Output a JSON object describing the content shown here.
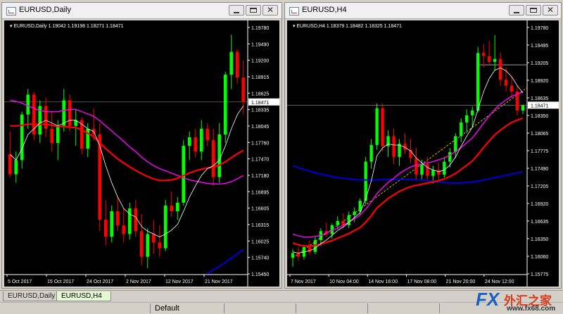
{
  "windows": [
    {
      "title": "EURUSD,Daily",
      "header": "EURUSD,Daily  1.19042 1.19198 1.18271 1.18471",
      "price_axis": [
        "1.19780",
        "1.19490",
        "1.19200",
        "1.18915",
        "1.18625",
        "1.18335",
        "1.18045",
        "1.17760",
        "1.17470",
        "1.17180",
        "1.16895",
        "1.16605",
        "1.16315",
        "1.16025",
        "1.15740",
        "1.15450"
      ],
      "price_min": 1.1545,
      "price_max": 1.1978,
      "current_price": "1.18471",
      "time_axis": [
        "5 Oct 2017",
        "15 Oct 2017",
        "24 Oct 2017",
        "2 Nov 2017",
        "12 Nov 2017",
        "21 Nov 2017"
      ],
      "candles": [
        [
          1.1755,
          1.1795,
          1.1715,
          1.172
        ],
        [
          1.172,
          1.176,
          1.1705,
          1.1745
        ],
        [
          1.1745,
          1.183,
          1.173,
          1.1825
        ],
        [
          1.1825,
          1.187,
          1.18,
          1.186
        ],
        [
          1.186,
          1.1865,
          1.178,
          1.179
        ],
        [
          1.179,
          1.185,
          1.1775,
          1.184
        ],
        [
          1.184,
          1.1855,
          1.1785,
          1.18
        ],
        [
          1.18,
          1.183,
          1.176,
          1.1775
        ],
        [
          1.1775,
          1.1815,
          1.1745,
          1.1805
        ],
        [
          1.1805,
          1.187,
          1.1795,
          1.185
        ],
        [
          1.185,
          1.186,
          1.1795,
          1.1805
        ],
        [
          1.1805,
          1.1835,
          1.177,
          1.1815
        ],
        [
          1.1815,
          1.182,
          1.1755,
          1.1765
        ],
        [
          1.1765,
          1.181,
          1.175,
          1.18
        ],
        [
          1.18,
          1.1835,
          1.178,
          1.179
        ],
        [
          1.179,
          1.181,
          1.162,
          1.164
        ],
        [
          1.164,
          1.1675,
          1.1595,
          1.161
        ],
        [
          1.161,
          1.1665,
          1.16,
          1.1655
        ],
        [
          1.1655,
          1.168,
          1.162,
          1.163
        ],
        [
          1.163,
          1.166,
          1.16,
          1.1615
        ],
        [
          1.1615,
          1.167,
          1.1605,
          1.166
        ],
        [
          1.166,
          1.1675,
          1.161,
          1.162
        ],
        [
          1.162,
          1.165,
          1.156,
          1.1575
        ],
        [
          1.1575,
          1.1625,
          1.1555,
          1.1615
        ],
        [
          1.1615,
          1.164,
          1.158,
          1.16
        ],
        [
          1.16,
          1.163,
          1.1575,
          1.159
        ],
        [
          1.159,
          1.1675,
          1.1585,
          1.1665
        ],
        [
          1.1665,
          1.169,
          1.1645,
          1.1655
        ],
        [
          1.1655,
          1.168,
          1.164,
          1.167
        ],
        [
          1.167,
          1.178,
          1.1665,
          1.177
        ],
        [
          1.177,
          1.1795,
          1.1745,
          1.1785
        ],
        [
          1.1785,
          1.18,
          1.175,
          1.176
        ],
        [
          1.176,
          1.1815,
          1.1745,
          1.18
        ],
        [
          1.18,
          1.181,
          1.177,
          1.178
        ],
        [
          1.178,
          1.18,
          1.17,
          1.1715
        ],
        [
          1.1715,
          1.181,
          1.1705,
          1.179
        ],
        [
          1.179,
          1.19,
          1.1775,
          1.1895
        ],
        [
          1.1895,
          1.1965,
          1.187,
          1.1935
        ],
        [
          1.1935,
          1.194,
          1.188,
          1.189
        ],
        [
          1.189,
          1.192,
          1.1825,
          1.1847
        ]
      ],
      "ma_fast": [
        1.1755,
        1.1745,
        1.1765,
        1.179,
        1.18,
        1.181,
        1.1815,
        1.181,
        1.1805,
        1.181,
        1.1815,
        1.1815,
        1.1808,
        1.18,
        1.1795,
        1.177,
        1.1735,
        1.1705,
        1.168,
        1.166,
        1.165,
        1.1645,
        1.1628,
        1.162,
        1.1615,
        1.161,
        1.1615,
        1.1622,
        1.1632,
        1.1655,
        1.168,
        1.17,
        1.1718,
        1.173,
        1.1735,
        1.1745,
        1.177,
        1.18,
        1.1825,
        1.184
      ],
      "ma_mid": [
        1.1805,
        1.1805,
        1.1806,
        1.1808,
        1.1808,
        1.1808,
        1.1808,
        1.1806,
        1.1804,
        1.1804,
        1.1803,
        1.1802,
        1.1798,
        1.1792,
        1.1786,
        1.1775,
        1.1765,
        1.1756,
        1.1747,
        1.174,
        1.1733,
        1.1727,
        1.1721,
        1.1716,
        1.1712,
        1.1709,
        1.1709,
        1.171,
        1.1713,
        1.1718,
        1.1722,
        1.1726,
        1.1729,
        1.1731,
        1.1733,
        1.1736,
        1.1742,
        1.1749,
        1.1756,
        1.1762
      ],
      "ma_magenta": [
        1.185,
        1.1848,
        1.1845,
        1.184,
        1.1836,
        1.1832,
        1.183,
        1.183,
        1.183,
        1.1832,
        1.1834,
        1.1834,
        1.183,
        1.1826,
        1.1822,
        1.1814,
        1.1805,
        1.1796,
        1.1787,
        1.1778,
        1.1768,
        1.176,
        1.175,
        1.1742,
        1.1735,
        1.173,
        1.1726,
        1.1722,
        1.1718,
        1.1714,
        1.171,
        1.1708,
        1.1706,
        1.1704,
        1.1703,
        1.1703,
        1.1704,
        1.1707,
        1.1712,
        1.1718
      ],
      "ma_blue": [
        null,
        null,
        null,
        null,
        null,
        null,
        null,
        null,
        null,
        null,
        null,
        null,
        null,
        null,
        null,
        null,
        null,
        null,
        null,
        null,
        null,
        null,
        null,
        null,
        null,
        null,
        null,
        null,
        null,
        null,
        null,
        null,
        null,
        1.1545,
        1.1552,
        1.1558,
        1.1565,
        1.1573,
        1.158,
        1.1588
      ]
    },
    {
      "title": "EURUSD,H4",
      "header": "EURUSD,H4  1.18379 1.18482 1.18325 1.18471",
      "price_axis": [
        "1.19780",
        "1.19495",
        "1.19205",
        "1.18920",
        "1.18635",
        "1.18350",
        "1.18065",
        "1.17775",
        "1.17490",
        "1.17205",
        "1.16920",
        "1.16635",
        "1.16350",
        "1.16060",
        "1.15775"
      ],
      "price_min": 1.1563,
      "price_max": 1.1978,
      "current_price": "1.18471",
      "resistance_price": 1.1915,
      "time_axis": [
        "7 Nov 2017",
        "10 Nov 04:00",
        "14 Nov 16:00",
        "17 Nov 08:00",
        "21 Nov 20:00",
        "24 Nov 12:00"
      ],
      "candles": [
        [
          1.159,
          1.1605,
          1.1575,
          1.1598
        ],
        [
          1.1598,
          1.1608,
          1.1585,
          1.1592
        ],
        [
          1.1592,
          1.1612,
          1.1587,
          1.1608
        ],
        [
          1.1608,
          1.162,
          1.1595,
          1.16
        ],
        [
          1.16,
          1.1625,
          1.1596,
          1.162
        ],
        [
          1.162,
          1.164,
          1.161,
          1.1635
        ],
        [
          1.1635,
          1.165,
          1.1625,
          1.163
        ],
        [
          1.163,
          1.1648,
          1.1622,
          1.1645
        ],
        [
          1.1645,
          1.166,
          1.1638,
          1.1652
        ],
        [
          1.1652,
          1.1665,
          1.164,
          1.1645
        ],
        [
          1.1645,
          1.1668,
          1.164,
          1.1662
        ],
        [
          1.1662,
          1.1675,
          1.165,
          1.1668
        ],
        [
          1.1668,
          1.169,
          1.1662,
          1.1686
        ],
        [
          1.1686,
          1.176,
          1.168,
          1.1752
        ],
        [
          1.1752,
          1.179,
          1.174,
          1.178
        ],
        [
          1.178,
          1.185,
          1.1772,
          1.1842
        ],
        [
          1.1842,
          1.185,
          1.177,
          1.1778
        ],
        [
          1.1778,
          1.1805,
          1.176,
          1.1795
        ],
        [
          1.1795,
          1.1808,
          1.1748,
          1.176
        ],
        [
          1.176,
          1.179,
          1.1745,
          1.1782
        ],
        [
          1.1782,
          1.18,
          1.1765,
          1.1772
        ],
        [
          1.1772,
          1.179,
          1.175,
          1.1758
        ],
        [
          1.1758,
          1.1775,
          1.172,
          1.173
        ],
        [
          1.173,
          1.1755,
          1.1722,
          1.1748
        ],
        [
          1.1748,
          1.176,
          1.1722,
          1.1728
        ],
        [
          1.1728,
          1.1745,
          1.1715,
          1.1738
        ],
        [
          1.1738,
          1.175,
          1.1722,
          1.173
        ],
        [
          1.173,
          1.176,
          1.1725,
          1.1752
        ],
        [
          1.1752,
          1.1775,
          1.1742,
          1.1768
        ],
        [
          1.1768,
          1.18,
          1.1758,
          1.1795
        ],
        [
          1.1795,
          1.1825,
          1.1785,
          1.1818
        ],
        [
          1.1818,
          1.184,
          1.18,
          1.183
        ],
        [
          1.183,
          1.1845,
          1.181,
          1.1838
        ],
        [
          1.1838,
          1.1945,
          1.1835,
          1.1935
        ],
        [
          1.1935,
          1.195,
          1.191,
          1.193
        ],
        [
          1.193,
          1.1955,
          1.1915,
          1.192
        ],
        [
          1.192,
          1.1965,
          1.1905,
          1.1925
        ],
        [
          1.1925,
          1.1935,
          1.188,
          1.189
        ],
        [
          1.189,
          1.191,
          1.187,
          1.188
        ],
        [
          1.188,
          1.1895,
          1.186,
          1.187
        ],
        [
          1.187,
          1.188,
          1.183,
          1.1838
        ],
        [
          1.1838,
          1.1848,
          1.1832,
          1.1847
        ]
      ],
      "ma_fast": [
        1.16,
        1.1598,
        1.16,
        1.1602,
        1.1606,
        1.1614,
        1.162,
        1.1628,
        1.1636,
        1.1642,
        1.165,
        1.1658,
        1.1666,
        1.169,
        1.172,
        1.1762,
        1.1775,
        1.1782,
        1.178,
        1.178,
        1.1776,
        1.177,
        1.1758,
        1.175,
        1.1742,
        1.1738,
        1.1735,
        1.1738,
        1.1746,
        1.176,
        1.1778,
        1.1795,
        1.181,
        1.184,
        1.187,
        1.1892,
        1.1906,
        1.191,
        1.1905,
        1.1895,
        1.188,
        1.1868
      ],
      "ma_mid": [
        1.1615,
        1.1612,
        1.161,
        1.161,
        1.1611,
        1.1613,
        1.1616,
        1.1619,
        1.1623,
        1.1627,
        1.1631,
        1.1636,
        1.1641,
        1.165,
        1.1661,
        1.1674,
        1.1682,
        1.169,
        1.1696,
        1.1702,
        1.1706,
        1.171,
        1.1712,
        1.1714,
        1.1716,
        1.1718,
        1.172,
        1.1723,
        1.1727,
        1.1732,
        1.1739,
        1.1746,
        1.1753,
        1.1764,
        1.1776,
        1.1787,
        1.1797,
        1.1805,
        1.1812,
        1.1818,
        1.1822,
        1.1825
      ],
      "ma_magenta": [
        1.163,
        1.1627,
        1.1625,
        1.1625,
        1.1626,
        1.1628,
        1.1632,
        1.1636,
        1.164,
        1.1645,
        1.165,
        1.1656,
        1.1662,
        1.1672,
        1.1684,
        1.1698,
        1.1708,
        1.1717,
        1.1724,
        1.1732,
        1.1738,
        1.1743,
        1.1746,
        1.1748,
        1.175,
        1.1752,
        1.1755,
        1.1758,
        1.1763,
        1.1769,
        1.1776,
        1.1784,
        1.1792,
        1.1804,
        1.1817,
        1.1829,
        1.184,
        1.1849,
        1.1856,
        1.1862,
        1.1866,
        1.1869
      ],
      "ma_blue": [
        1.1745,
        1.1742,
        1.1739,
        1.1736,
        1.1733,
        1.1731,
        1.1729,
        1.1727,
        1.1725,
        1.1724,
        1.1723,
        1.1722,
        1.1721,
        1.1721,
        1.1721,
        1.1721,
        1.1722,
        1.1722,
        1.1722,
        1.1722,
        1.1722,
        1.1722,
        1.1721,
        1.1721,
        1.172,
        1.1719,
        1.1718,
        1.1717,
        1.1716,
        1.1716,
        1.1716,
        1.1717,
        1.1718,
        1.1719,
        1.1721,
        1.1723,
        1.1725,
        1.1727,
        1.1729,
        1.1731,
        1.1733,
        1.1735
      ],
      "trendline": [
        [
          0,
          1.159
        ],
        [
          41,
          1.186
        ]
      ]
    }
  ],
  "tabs": [
    "EURUSD,Daily",
    "EURUSD,H4"
  ],
  "status": {
    "profile": "Default"
  },
  "watermark": {
    "logo": "FX",
    "name_cn": "外汇之家",
    "url": "www.fx68.com"
  },
  "colors": {
    "bull": "#00ff00",
    "bear": "#ff0000",
    "ma_fast": "#ffffff",
    "ma_mid": "#ff0000",
    "ma_magenta": "#ff00ff",
    "ma_blue": "#0000c8",
    "grid_line": "#808080",
    "trendline": "#ffd700"
  }
}
